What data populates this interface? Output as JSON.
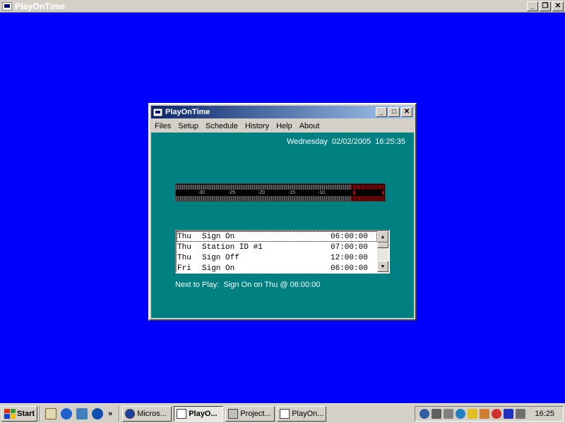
{
  "outer_window": {
    "title": "PlayOnTime"
  },
  "dialog": {
    "title": "PlayOnTime",
    "menu": [
      "Files",
      "Setup",
      "Schedule",
      "History",
      "Help",
      "About"
    ],
    "datetime": "Wednesday  02/02/2005  16:25:35",
    "meter": {
      "ticks": [
        "-30",
        "-25",
        "-20",
        "-15",
        "-10"
      ],
      "level_db": -5
    },
    "schedule": [
      {
        "day": "Thu",
        "event": "Sign On",
        "time": "06:00:00"
      },
      {
        "day": "Thu",
        "event": "Station ID #1",
        "time": "07:00:00"
      },
      {
        "day": "Thu",
        "event": "Sign Off",
        "time": "12:00:00"
      },
      {
        "day": "Fri",
        "event": "Sign On",
        "time": "06:00:00"
      }
    ],
    "next_to_play": "Next to Play:  Sign On on Thu @ 06:00:00"
  },
  "taskbar": {
    "start_label": "Start",
    "tasks": [
      {
        "label": "Micros...",
        "icon": "no-entry-icon",
        "active": false
      },
      {
        "label": "PlayO...",
        "icon": "app-window-icon",
        "active": true
      },
      {
        "label": "Project...",
        "icon": "project-icon",
        "active": false
      },
      {
        "label": "PlayOn...",
        "icon": "app-window-icon",
        "active": false
      }
    ],
    "clock": "16:25"
  }
}
